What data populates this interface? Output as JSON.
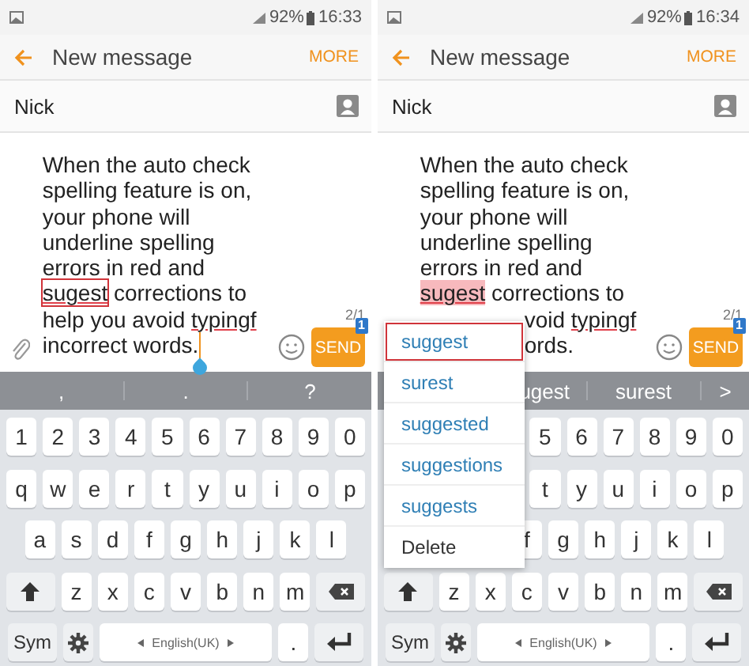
{
  "panels": [
    {
      "status_bar": {
        "battery": "92%",
        "time": "16:33"
      },
      "app_bar": {
        "title": "New message",
        "action": "MORE"
      },
      "recipient": "Nick",
      "message": {
        "cursor": true,
        "attach": true,
        "lines": [
          {
            "kind": "full",
            "segments": [
              {
                "text": "When the auto check",
                "misspelled": false,
                "outlined": false,
                "highlighted": false
              }
            ]
          },
          {
            "kind": "full",
            "segments": [
              {
                "text": "spelling feature is on,",
                "misspelled": false,
                "outlined": false,
                "highlighted": false
              }
            ]
          },
          {
            "kind": "full",
            "segments": [
              {
                "text": "your phone will",
                "misspelled": false,
                "outlined": false,
                "highlighted": false
              }
            ]
          },
          {
            "kind": "full",
            "segments": [
              {
                "text": "underline spelling",
                "misspelled": false,
                "outlined": false,
                "highlighted": false
              }
            ]
          },
          {
            "kind": "full",
            "segments": [
              {
                "text": "errors in red and",
                "misspelled": false,
                "outlined": false,
                "highlighted": false
              }
            ]
          },
          {
            "kind": "full",
            "segments": [
              {
                "text": "sugest",
                "misspelled": true,
                "outlined": true,
                "highlighted": false
              },
              {
                "text": " corrections to",
                "misspelled": false,
                "outlined": false,
                "highlighted": false
              }
            ]
          },
          {
            "kind": "full",
            "segments": [
              {
                "text": "help you avoid ",
                "misspelled": false,
                "outlined": false,
                "highlighted": false
              },
              {
                "text": "typingf",
                "misspelled": true,
                "outlined": false,
                "highlighted": false
              }
            ]
          },
          {
            "kind": "full",
            "segments": [
              {
                "text": "incorrect words.",
                "misspelled": false,
                "outlined": false,
                "highlighted": false
              }
            ]
          }
        ]
      },
      "counter": "2/1",
      "send": {
        "label": "SEND",
        "badge": "1"
      },
      "suggestions": [
        {
          "kind": "word",
          "text": ","
        },
        {
          "kind": "word",
          "text": "."
        },
        {
          "kind": "word",
          "text": "?"
        }
      ],
      "keyboard": {
        "rows": [
          {
            "keys": [
              {
                "kind": "char",
                "label": "1"
              },
              {
                "kind": "char",
                "label": "2"
              },
              {
                "kind": "char",
                "label": "3"
              },
              {
                "kind": "char",
                "label": "4"
              },
              {
                "kind": "char",
                "label": "5"
              },
              {
                "kind": "char",
                "label": "6"
              },
              {
                "kind": "char",
                "label": "7"
              },
              {
                "kind": "char",
                "label": "8"
              },
              {
                "kind": "char",
                "label": "9"
              },
              {
                "kind": "char",
                "label": "0"
              }
            ]
          },
          {
            "keys": [
              {
                "kind": "char",
                "label": "q"
              },
              {
                "kind": "char",
                "label": "w"
              },
              {
                "kind": "char",
                "label": "e"
              },
              {
                "kind": "char",
                "label": "r"
              },
              {
                "kind": "char",
                "label": "t"
              },
              {
                "kind": "char",
                "label": "y"
              },
              {
                "kind": "char",
                "label": "u"
              },
              {
                "kind": "char",
                "label": "i"
              },
              {
                "kind": "char",
                "label": "o"
              },
              {
                "kind": "char",
                "label": "p"
              }
            ]
          },
          {
            "keys": [
              {
                "kind": "char",
                "label": "a"
              },
              {
                "kind": "char",
                "label": "s"
              },
              {
                "kind": "char",
                "label": "d"
              },
              {
                "kind": "char",
                "label": "f"
              },
              {
                "kind": "char",
                "label": "g"
              },
              {
                "kind": "char",
                "label": "h"
              },
              {
                "kind": "char",
                "label": "j"
              },
              {
                "kind": "char",
                "label": "k"
              },
              {
                "kind": "char",
                "label": "l"
              }
            ]
          },
          {
            "keys": [
              {
                "kind": "shift"
              },
              {
                "kind": "char",
                "label": "z"
              },
              {
                "kind": "char",
                "label": "x"
              },
              {
                "kind": "char",
                "label": "c"
              },
              {
                "kind": "char",
                "label": "v"
              },
              {
                "kind": "char",
                "label": "b"
              },
              {
                "kind": "char",
                "label": "n"
              },
              {
                "kind": "char",
                "label": "m"
              },
              {
                "kind": "backspace"
              }
            ]
          },
          {
            "keys": [
              {
                "kind": "sym",
                "label": "Sym"
              },
              {
                "kind": "settings"
              },
              {
                "kind": "space",
                "label": "English(UK)"
              },
              {
                "kind": "char",
                "label": "."
              },
              {
                "kind": "enter"
              }
            ]
          }
        ]
      }
    },
    {
      "status_bar": {
        "battery": "92%",
        "time": "16:34"
      },
      "app_bar": {
        "title": "New message",
        "action": "MORE"
      },
      "recipient": "Nick",
      "message": {
        "lines": [
          {
            "kind": "full",
            "segments": [
              {
                "text": "When the auto check",
                "misspelled": false,
                "outlined": false,
                "highlighted": false
              }
            ]
          },
          {
            "kind": "full",
            "segments": [
              {
                "text": "spelling feature is on,",
                "misspelled": false,
                "outlined": false,
                "highlighted": false
              }
            ]
          },
          {
            "kind": "full",
            "segments": [
              {
                "text": "your phone will",
                "misspelled": false,
                "outlined": false,
                "highlighted": false
              }
            ]
          },
          {
            "kind": "full",
            "segments": [
              {
                "text": "underline spelling",
                "misspelled": false,
                "outlined": false,
                "highlighted": false
              }
            ]
          },
          {
            "kind": "full",
            "segments": [
              {
                "text": "errors in red and",
                "misspelled": false,
                "outlined": false,
                "highlighted": false
              }
            ]
          },
          {
            "kind": "full",
            "segments": [
              {
                "text": "sugest",
                "misspelled": true,
                "outlined": false,
                "highlighted": true
              },
              {
                "text": " corrections to",
                "misspelled": false,
                "outlined": false,
                "highlighted": false
              }
            ]
          },
          {
            "kind": "clipped",
            "segments": [
              {
                "text": "void ",
                "misspelled": false,
                "outlined": false,
                "highlighted": false
              },
              {
                "text": "typingf",
                "misspelled": true,
                "outlined": false,
                "highlighted": false
              }
            ]
          },
          {
            "kind": "clipped",
            "segments": [
              {
                "text": "ords.",
                "misspelled": false,
                "outlined": false,
                "highlighted": false
              }
            ]
          }
        ]
      },
      "counter": "2/1",
      "send": {
        "label": "SEND",
        "badge": "1"
      },
      "suggestions": [
        {
          "kind": "clipped",
          "text": "ugest"
        },
        {
          "kind": "word",
          "text": "surest"
        },
        {
          "kind": "more",
          "text": ">"
        }
      ],
      "keyboard": {
        "rows": [
          {
            "keys": [
              {
                "kind": "covered"
              },
              {
                "kind": "covered"
              },
              {
                "kind": "covered"
              },
              {
                "kind": "covered"
              },
              {
                "kind": "char",
                "label": "5"
              },
              {
                "kind": "char",
                "label": "6"
              },
              {
                "kind": "char",
                "label": "7"
              },
              {
                "kind": "char",
                "label": "8"
              },
              {
                "kind": "char",
                "label": "9"
              },
              {
                "kind": "char",
                "label": "0"
              }
            ]
          },
          {
            "keys": [
              {
                "kind": "covered"
              },
              {
                "kind": "covered"
              },
              {
                "kind": "covered"
              },
              {
                "kind": "covered"
              },
              {
                "kind": "char",
                "label": "t"
              },
              {
                "kind": "char",
                "label": "y"
              },
              {
                "kind": "char",
                "label": "u"
              },
              {
                "kind": "char",
                "label": "i"
              },
              {
                "kind": "char",
                "label": "o"
              },
              {
                "kind": "char",
                "label": "p"
              }
            ]
          },
          {
            "keys": [
              {
                "kind": "covered"
              },
              {
                "kind": "covered"
              },
              {
                "kind": "covered"
              },
              {
                "kind": "char",
                "label": "f"
              },
              {
                "kind": "char",
                "label": "g"
              },
              {
                "kind": "char",
                "label": "h"
              },
              {
                "kind": "char",
                "label": "j"
              },
              {
                "kind": "char",
                "label": "k"
              },
              {
                "kind": "char",
                "label": "l"
              }
            ]
          },
          {
            "keys": [
              {
                "kind": "shift"
              },
              {
                "kind": "char",
                "label": "z"
              },
              {
                "kind": "char",
                "label": "x"
              },
              {
                "kind": "char",
                "label": "c"
              },
              {
                "kind": "char",
                "label": "v"
              },
              {
                "kind": "char",
                "label": "b"
              },
              {
                "kind": "char",
                "label": "n"
              },
              {
                "kind": "char",
                "label": "m"
              },
              {
                "kind": "backspace"
              }
            ]
          },
          {
            "keys": [
              {
                "kind": "sym",
                "label": "Sym"
              },
              {
                "kind": "settings"
              },
              {
                "kind": "space",
                "label": "English(UK)"
              },
              {
                "kind": "char",
                "label": "."
              },
              {
                "kind": "enter"
              }
            ]
          }
        ]
      },
      "menu": [
        {
          "kind": "suggestion",
          "text": "suggest",
          "outlined": true
        },
        {
          "kind": "suggestion",
          "text": "surest",
          "outlined": false
        },
        {
          "kind": "suggestion",
          "text": "suggested",
          "outlined": false
        },
        {
          "kind": "suggestion",
          "text": "suggestions",
          "outlined": false
        },
        {
          "kind": "suggestion",
          "text": "suggests",
          "outlined": false
        },
        {
          "kind": "action",
          "text": "Delete",
          "outlined": false
        }
      ]
    }
  ]
}
